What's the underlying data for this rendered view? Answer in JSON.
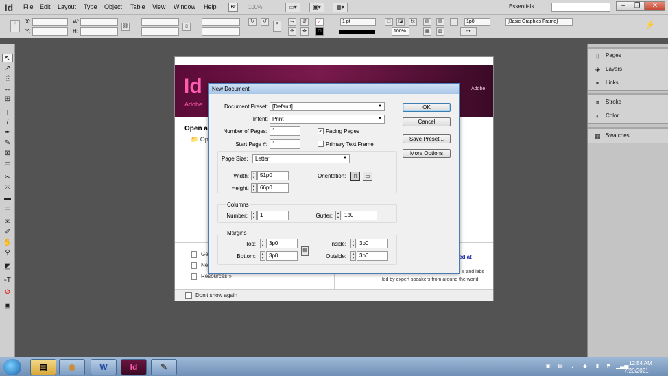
{
  "app": {
    "logo": "Id"
  },
  "menubar": {
    "items": [
      "File",
      "Edit",
      "Layout",
      "Type",
      "Object",
      "Table",
      "View",
      "Window",
      "Help"
    ],
    "zoom": "100%",
    "workspace": "Essentials",
    "window_controls": {
      "minimize": "–",
      "restore": "❐",
      "close": "✕"
    }
  },
  "control_panel": {
    "x_label": "X:",
    "y_label": "Y:",
    "w_label": "W:",
    "h_label": "H:",
    "stroke_weight": "1 pt",
    "zoom_field": "100%",
    "offset_field": "1p0",
    "object_style": "[Basic Graphics Frame]"
  },
  "panels": {
    "group1": [
      "Pages",
      "Layers",
      "Links"
    ],
    "group2": [
      "Stroke",
      "Color"
    ],
    "group3": [
      "Swatches"
    ]
  },
  "welcome": {
    "logo": "Id",
    "adobe_left": "Adobe",
    "adobe_right": "Adobe",
    "open_heading": "Open a",
    "folder_item": "Op",
    "links": [
      "Ge",
      "Ne",
      "Resources »"
    ],
    "blue_text": "red at",
    "right_text1": "s and labs",
    "right_text2": "led by expert speakers from around the world.",
    "dont_show": "Don't show again"
  },
  "dialog": {
    "title": "New Document",
    "document_preset_label": "Document Preset:",
    "document_preset_value": "[Default]",
    "intent_label": "Intent:",
    "intent_value": "Print",
    "num_pages_label": "Number of Pages:",
    "num_pages_value": "1",
    "facing_pages_label": "Facing Pages",
    "facing_pages_checked": true,
    "start_page_label": "Start Page #:",
    "start_page_value": "1",
    "primary_text_frame_label": "Primary Text Frame",
    "primary_text_frame_checked": false,
    "page_size_label": "Page Size:",
    "page_size_value": "Letter",
    "width_label": "Width:",
    "width_value": "51p0",
    "height_label": "Height:",
    "height_value": "66p0",
    "orientation_label": "Orientation:",
    "columns_title": "Columns",
    "columns_number_label": "Number:",
    "columns_number_value": "1",
    "gutter_label": "Gutter:",
    "gutter_value": "1p0",
    "margins_title": "Margins",
    "top_label": "Top:",
    "top_value": "3p0",
    "bottom_label": "Bottom:",
    "bottom_value": "3p0",
    "inside_label": "Inside:",
    "inside_value": "3p0",
    "outside_label": "Outside:",
    "outside_value": "3p0",
    "buttons": {
      "ok": "OK",
      "cancel": "Cancel",
      "save_preset": "Save Preset...",
      "more_options": "More Options"
    }
  },
  "taskbar": {
    "apps": [
      "W",
      "Id"
    ],
    "time": "12:54 AM",
    "date": "7/20/2021"
  }
}
